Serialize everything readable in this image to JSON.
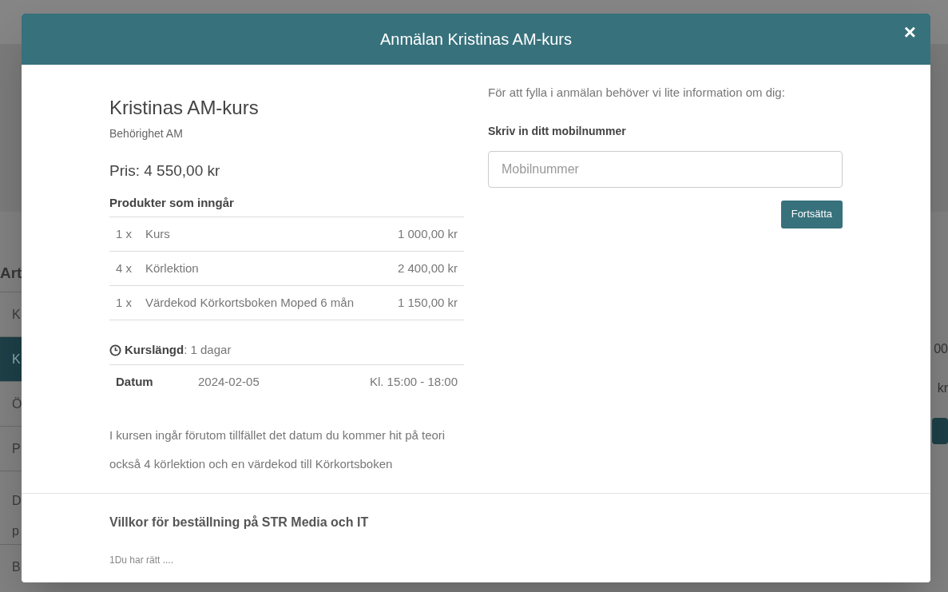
{
  "background": {
    "heading": "Art",
    "items": [
      {
        "label": "K",
        "selected": false
      },
      {
        "label": "K",
        "selected": true
      },
      {
        "label": "Ö",
        "selected": false
      },
      {
        "label": "P",
        "selected": false
      },
      {
        "label": "D\np",
        "selected": false
      },
      {
        "label": "B",
        "selected": false
      }
    ],
    "right_texts": [
      "00",
      "kr"
    ]
  },
  "modal": {
    "title": "Anmälan Kristinas AM-kurs",
    "close": "×",
    "course": {
      "name": "Kristinas AM-kurs",
      "subtitle": "Behörighet AM",
      "price": "Pris: 4 550,00 kr",
      "products_heading": "Produkter som inngår",
      "products": [
        {
          "qty": "1 x",
          "name": "Kurs",
          "price": "1 000,00 kr"
        },
        {
          "qty": "4 x",
          "name": "Körlektion",
          "price": "2 400,00 kr"
        },
        {
          "qty": "1 x",
          "name": "Värdekod Körkortsboken Moped 6 mån",
          "price": "1 150,00 kr"
        }
      ],
      "duration": "**Kurslängd**: 1 dagar",
      "dates": [
        {
          "label": "Datum",
          "date": "2024-02-05",
          "time": "Kl. 15:00 - 18:00"
        }
      ],
      "description": "I kursen ingår förutom tillfället det datum du kommer hit på teori också 4 körlektion och en värdekod till Körkortsboken"
    },
    "form": {
      "intro": "För att fylla i anmälan behöver vi lite information om dig:",
      "label": "Skriv in ditt mobilnummer",
      "placeholder": "Mobilnummer",
      "button": "Fortsätta"
    },
    "terms": {
      "heading": "Villkor för beställning på STR Media och IT",
      "text": "1Du har rätt ...."
    }
  }
}
